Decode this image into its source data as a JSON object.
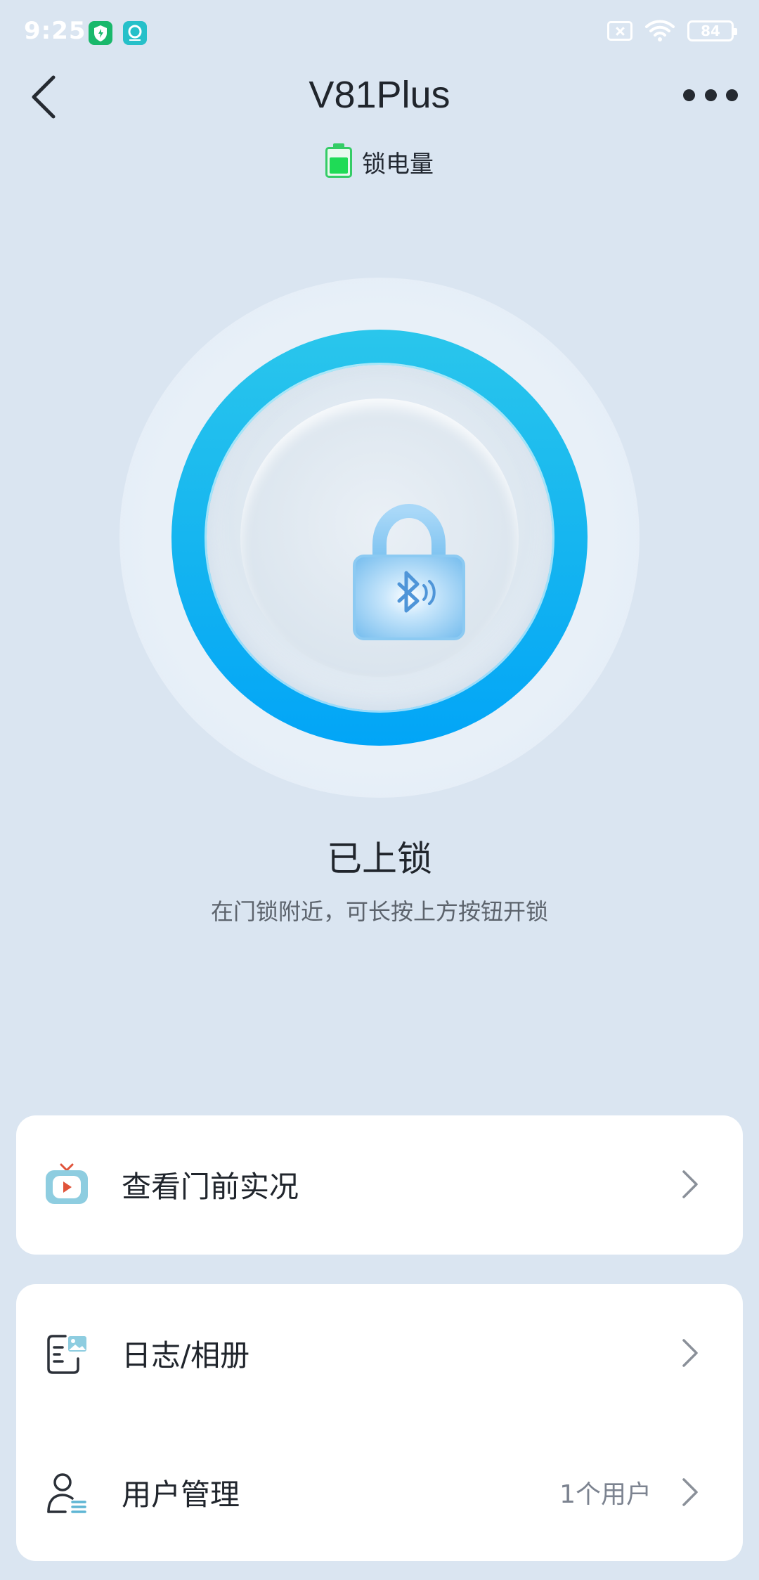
{
  "status_bar": {
    "time": "9:25",
    "battery_level": "84",
    "icons": [
      "shield-app-icon",
      "circle-app-icon",
      "sim-off-icon",
      "wifi-icon",
      "battery-icon"
    ]
  },
  "header": {
    "title": "V81Plus",
    "back_icon": "chevron-left-icon",
    "more_icon": "more-dots-icon"
  },
  "lock_battery": {
    "label": "锁电量",
    "level_fraction": 0.6,
    "color": "#1fdb56"
  },
  "lock_button": {
    "state": "已上锁",
    "hint": "在门锁附近，可长按上方按钮开锁",
    "ring_color": "#14b4f0",
    "icon": "bluetooth-padlock-icon"
  },
  "cards": {
    "live_view": {
      "label": "查看门前实况",
      "icon": "tv-play-icon"
    },
    "logs": {
      "label": "日志/相册",
      "icon": "log-album-icon"
    },
    "users": {
      "label": "用户管理",
      "count": "1个用户",
      "icon": "user-manage-icon"
    }
  }
}
